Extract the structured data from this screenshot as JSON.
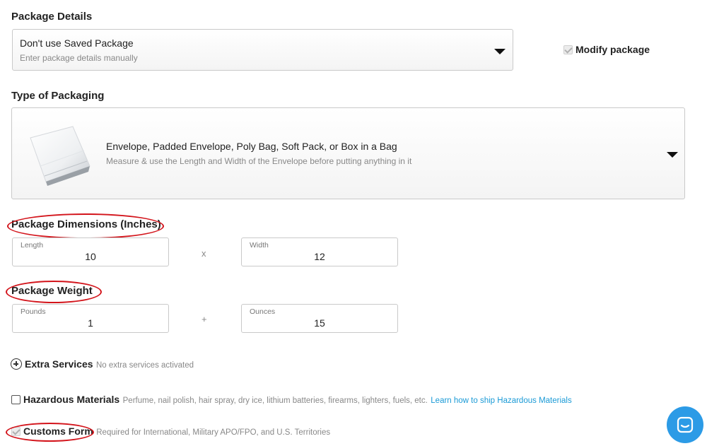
{
  "package_details": {
    "title": "Package Details",
    "saved_package": {
      "selected": "Don't use Saved Package",
      "hint": "Enter package details manually"
    },
    "modify_label": "Modify package"
  },
  "packaging": {
    "title": "Type of Packaging",
    "selected": "Envelope, Padded Envelope, Poly Bag, Soft Pack, or Box in a Bag",
    "hint": "Measure & use the Length and Width of the Envelope before putting anything in it"
  },
  "dimensions": {
    "title": "Package Dimensions (Inches)",
    "length_label": "Length",
    "length_value": "10",
    "separator": "x",
    "width_label": "Width",
    "width_value": "12"
  },
  "weight": {
    "title": "Package Weight",
    "pounds_label": "Pounds",
    "pounds_value": "1",
    "separator": "+",
    "ounces_label": "Ounces",
    "ounces_value": "15"
  },
  "extra_services": {
    "label": "Extra Services",
    "status": "No extra services activated"
  },
  "hazardous": {
    "label": "Hazardous Materials",
    "description": "Perfume, nail polish, hair spray, dry ice, lithium batteries, firearms, lighters, fuels, etc.",
    "link": "Learn how to ship Hazardous Materials"
  },
  "customs": {
    "label": "Customs Form",
    "description": "Required for International, Military APO/FPO, and U.S. Territories"
  },
  "colors": {
    "accent_link": "#1a9ad6",
    "annotation_red": "#d3141b",
    "chat_blue": "#2c9be6"
  }
}
